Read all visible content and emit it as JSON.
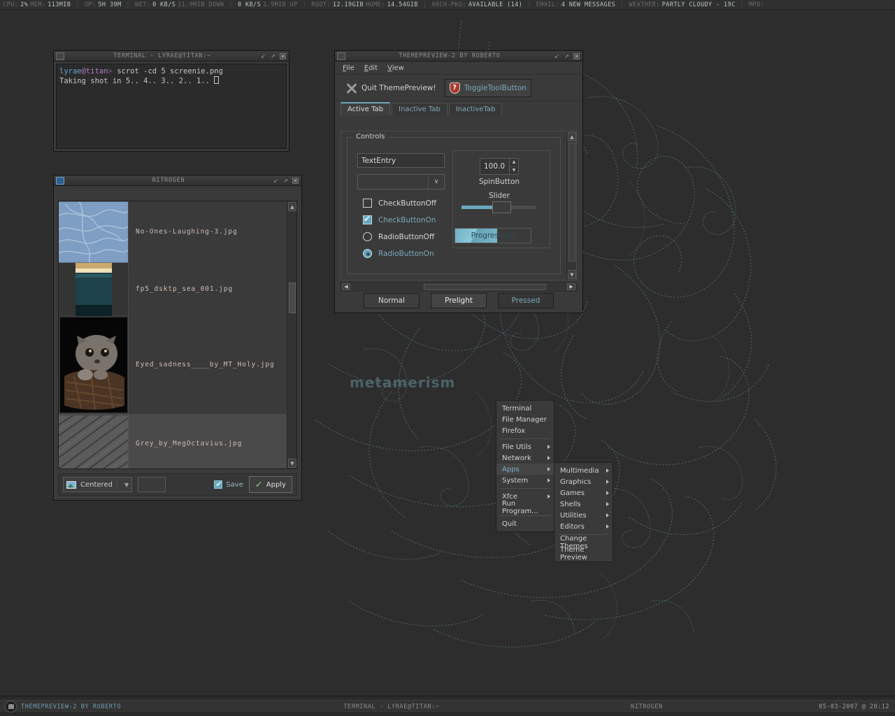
{
  "topbar": {
    "items": [
      {
        "key": "CPU:",
        "val": "2%"
      },
      {
        "key": "MEM:",
        "val": "113MIB"
      },
      {
        "key": "UP:",
        "val": "5H 39M"
      },
      {
        "key": "NET:",
        "val": "0 KB/S"
      },
      {
        "key": "11.9MIB DOWN",
        "val": ""
      },
      {
        "key": "",
        "val": "0 KB/S"
      },
      {
        "key": "1.9MIB UP",
        "val": ""
      },
      {
        "key": "ROOT:",
        "val": "12.19GIB"
      },
      {
        "key": "HOME:",
        "val": "14.54GIB"
      },
      {
        "key": "ARCH-PKG:",
        "val": "AVAILABLE (14)"
      },
      {
        "key": "EMAIL:",
        "val": "4 NEW MESSAGES"
      },
      {
        "key": "WEATHER:",
        "val": "PARTLY CLOUDY - 19C"
      },
      {
        "key": "MPD:",
        "val": ""
      }
    ]
  },
  "wallpaper": {
    "word": "metamerism"
  },
  "terminal": {
    "title": "TERMINAL - LYRAE@TITAN:~",
    "prompt_user": "lyrae",
    "prompt_host": "@titan",
    "prompt_symbol": ">",
    "command": " scrot -cd 5 screenie.png",
    "output": "Taking shot in 5.. 4.. 3.. 2.. 1.. "
  },
  "nitrogen": {
    "title": "NITROGEN",
    "rows": [
      {
        "name": "No-Ones-Laughing-3.jpg",
        "selected": false,
        "thumb": "clouds"
      },
      {
        "name": "fp5_dsktp_sea_001.jpg",
        "selected": false,
        "thumb": "sea"
      },
      {
        "name": "Eyed_sadness____by_MT_Holy.jpg",
        "selected": false,
        "thumb": "cat"
      },
      {
        "name": "Grey_by_MegOctavius.jpg",
        "selected": true,
        "thumb": "wood"
      }
    ],
    "mode_label": "Centered",
    "save_label": "Save",
    "apply_label": "Apply"
  },
  "themepreview": {
    "title": "THEMEPREVIEW-2 BY ROBERTO",
    "menus": [
      "File",
      "Edit",
      "View"
    ],
    "toolbar": {
      "quit_label": "Quit ThemePreview!",
      "toggle_label": "ToggleToolButton",
      "question_glyph": "?"
    },
    "tabs": [
      {
        "label": "Active Tab",
        "active": true
      },
      {
        "label": "Inactive Tab",
        "active": false
      },
      {
        "label": "InactiveTab",
        "active": false
      }
    ],
    "group_legend": "Controls",
    "text_entry_value": "TextEntry",
    "checks": [
      {
        "label": "CheckButtonOff",
        "type": "check",
        "on": false
      },
      {
        "label": "CheckButtonOn",
        "type": "check",
        "on": true
      },
      {
        "label": "RadioButtonOff",
        "type": "radio",
        "on": false
      },
      {
        "label": "RadioButtonOn",
        "type": "radio",
        "on": true
      }
    ],
    "spin_value": "100.0",
    "spin_caption": "SpinButton",
    "slider_caption": "Slider",
    "progress_label": "ProgressBar",
    "buttons": [
      {
        "label": "Normal",
        "state": "normal"
      },
      {
        "label": "Prelight",
        "state": "prelight"
      },
      {
        "label": "Pressed",
        "state": "pressed"
      }
    ]
  },
  "context_menu": {
    "root": [
      {
        "label": "Terminal",
        "submenu": false,
        "sep_after": false,
        "hl": false
      },
      {
        "label": "File Manager",
        "submenu": false,
        "sep_after": false,
        "hl": false
      },
      {
        "label": "Firefox",
        "submenu": false,
        "sep_after": true,
        "hl": false
      },
      {
        "label": "File Utils",
        "submenu": true,
        "sep_after": false,
        "hl": false
      },
      {
        "label": "Network",
        "submenu": true,
        "sep_after": false,
        "hl": false
      },
      {
        "label": "Apps",
        "submenu": true,
        "sep_after": false,
        "hl": true
      },
      {
        "label": "System",
        "submenu": true,
        "sep_after": true,
        "hl": false
      },
      {
        "label": "Xfce",
        "submenu": true,
        "sep_after": false,
        "hl": false
      },
      {
        "label": "Run Program...",
        "submenu": false,
        "sep_after": true,
        "hl": false
      },
      {
        "label": "Quit",
        "submenu": false,
        "sep_after": false,
        "hl": false
      }
    ],
    "submenu": [
      {
        "label": "Multimedia",
        "submenu": true,
        "sep_after": false
      },
      {
        "label": "Graphics",
        "submenu": true,
        "sep_after": false
      },
      {
        "label": "Games",
        "submenu": true,
        "sep_after": false
      },
      {
        "label": "Shells",
        "submenu": true,
        "sep_after": false
      },
      {
        "label": "Utilities",
        "submenu": true,
        "sep_after": false
      },
      {
        "label": "Editors",
        "submenu": true,
        "sep_after": true
      },
      {
        "label": "Change Themes",
        "submenu": false,
        "sep_after": false
      },
      {
        "label": "Theme Preview",
        "submenu": false,
        "sep_after": false
      }
    ]
  },
  "taskbar": {
    "tasks": [
      {
        "label": "THEMEPREVIEW-2 BY ROBERTO",
        "active": true
      },
      {
        "label": "TERMINAL - LYRAE@TITAN:~",
        "active": false
      },
      {
        "label": "NITROGEN",
        "active": false
      }
    ],
    "clock": "05-03-2007 @ 20:12"
  },
  "colors": {
    "accent": "#6fa8bd",
    "desktop": "#2d2d2d",
    "window": "#3a3a3a",
    "filename": "#cdbdb4"
  }
}
